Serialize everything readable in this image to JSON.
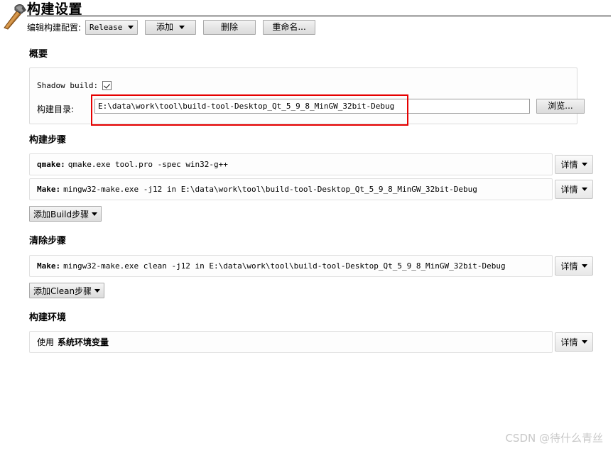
{
  "window": {
    "title": "构建设置",
    "icon": "hammer-icon"
  },
  "config_row": {
    "label": "编辑构建配置:",
    "configuration": "Release",
    "add_label": "添加",
    "delete_label": "删除",
    "rename_label": "重命名..."
  },
  "summary": {
    "heading": "概要",
    "shadow_build_label": "Shadow build:",
    "shadow_build_checked": true,
    "build_directory_label": "构建目录:",
    "build_directory_value": "E:\\data\\work\\tool\\build-tool-Desktop_Qt_5_9_8_MinGW_32bit-Debug",
    "browse_label": "浏览..."
  },
  "annotation": {
    "color": "#e60000",
    "target": "build-directory-field"
  },
  "build_steps": {
    "heading": "构建步骤",
    "steps": [
      {
        "kind": "qmake:",
        "command": "qmake.exe tool.pro -spec win32-g++",
        "details_label": "详情"
      },
      {
        "kind": "Make:",
        "command": "mingw32-make.exe -j12 in E:\\data\\work\\tool\\build-tool-Desktop_Qt_5_9_8_MinGW_32bit-Debug",
        "details_label": "详情"
      }
    ],
    "add_step_label": "添加Build步骤"
  },
  "clean_steps": {
    "heading": "清除步骤",
    "steps": [
      {
        "kind": "Make:",
        "command": "mingw32-make.exe clean -j12 in E:\\data\\work\\tool\\build-tool-Desktop_Qt_5_9_8_MinGW_32bit-Debug",
        "details_label": "详情"
      }
    ],
    "add_step_label": "添加Clean步骤"
  },
  "build_environment": {
    "heading": "构建环境",
    "use_label": "使用",
    "value": "系统环境变量",
    "details_label": "详情"
  },
  "watermark": {
    "text": "CSDN @待什么青丝"
  }
}
